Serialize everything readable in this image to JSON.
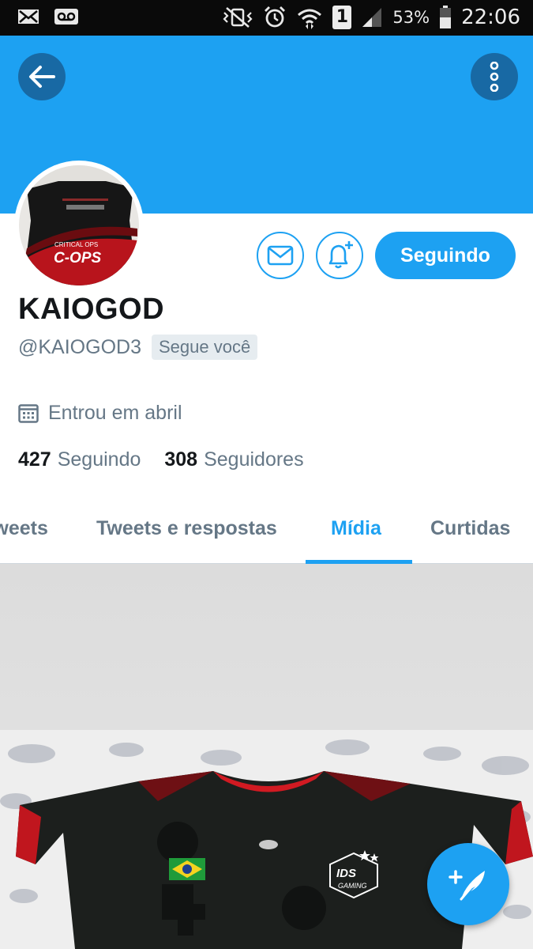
{
  "status_bar": {
    "battery_percent": "53%",
    "time": "22:06",
    "sim_slot": "1",
    "icons": [
      "mail-icon",
      "voicemail-icon",
      "vibrate-mute-icon",
      "alarm-icon",
      "wifi-icon",
      "sim-icon",
      "signal-icon",
      "battery-icon"
    ]
  },
  "header": {
    "back_icon": "arrow-left-icon",
    "more_icon": "vertical-dots-icon",
    "banner_color": "#1da1f2"
  },
  "profile": {
    "name": "KAIOGOD",
    "handle": "@KAIOGOD3",
    "follows_you_badge": "Segue você",
    "joined": "Entrou em abril",
    "following_count": "427",
    "following_label": "Seguindo",
    "followers_count": "308",
    "followers_label": "Seguidores",
    "avatar_caption": "C-OPS",
    "avatar_small_text": "CRITICAL OPS"
  },
  "actions": {
    "message_icon": "envelope-icon",
    "notify_icon": "bell-plus-icon",
    "follow_button_label": "Seguindo",
    "accent": "#1da1f2"
  },
  "tabs": [
    {
      "label": "Tweets",
      "active": false
    },
    {
      "label": "Tweets e respostas",
      "active": false
    },
    {
      "label": "Mídia",
      "active": true
    },
    {
      "label": "Curtidas",
      "active": false
    }
  ],
  "media": {
    "jersey_logo_main": "IDS",
    "jersey_logo_sub": "GAMING"
  },
  "fab": {
    "icon": "compose-feather-icon"
  }
}
